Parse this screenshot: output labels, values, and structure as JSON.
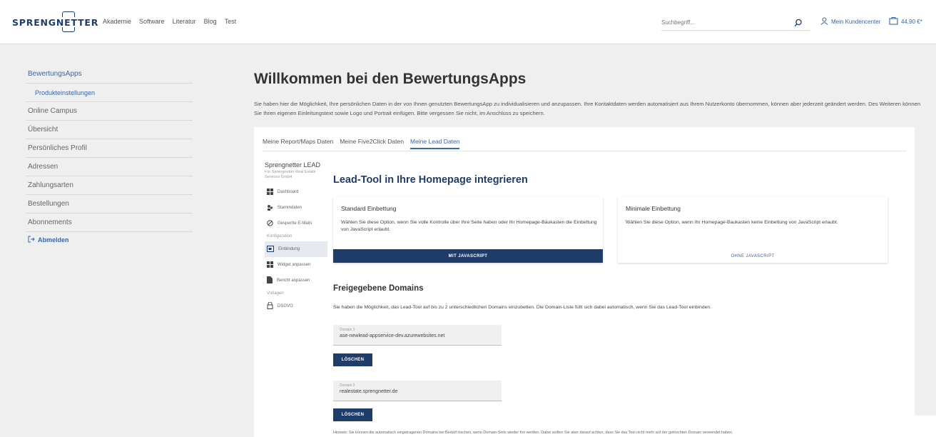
{
  "header": {
    "logo": "SPRENGNETTER",
    "nav": [
      "Akademie",
      "Software",
      "Literatur",
      "Blog",
      "Test"
    ],
    "search_placeholder": "Suchbegriff...",
    "account_label": "Mein Kundencenter",
    "cart_amount": "44,90 €*",
    "accent_color": "#3a67a8"
  },
  "sidebar": {
    "items": [
      {
        "label": "BewertungsApps",
        "active": true
      },
      {
        "label": "Produkteinstellungen",
        "sub": true
      },
      {
        "label": "Online Campus"
      },
      {
        "label": "Übersicht"
      },
      {
        "label": "Persönliches Profil"
      },
      {
        "label": "Adressen"
      },
      {
        "label": "Zahlungsarten"
      },
      {
        "label": "Bestellungen"
      },
      {
        "label": "Abonnements"
      }
    ],
    "logout": "Abmelden"
  },
  "main": {
    "title": "Willkommen bei den BewertungsApps",
    "intro": "Sie haben hier die Möglichkeit, Ihre persönlichen Daten in der von Ihnen genutzten BewertungsApp zu individualisieren und anzupassen. Ihre Kontaktdaten werden automatisiert aus Ihrem Nutzerkonto übernommen, können aber jederzeit geändert werden. Des Weiteren können Sie Ihren eigenen Einleitungstext sowie Logo und Portrait einfügen. Bitte vergessen Sie nicht, im Anschluss zu speichern.",
    "tabs": [
      {
        "label": "Meine Report/Maps Daten"
      },
      {
        "label": "Meine Five2Click Daten"
      },
      {
        "label": "Meine Lead Daten",
        "active": true
      }
    ]
  },
  "leadnav": {
    "brand": "Sprengnetter LEAD",
    "brand_sub": "Für Sprengnetter Real Estate Services GmbH",
    "items": [
      {
        "label": "Dashboard",
        "icon": "dashboard-icon"
      },
      {
        "label": "Stammdaten",
        "icon": "users-icon"
      },
      {
        "label": "Gesperrte E-Mails",
        "icon": "blocked-icon"
      }
    ],
    "section_config": "Konfiguration",
    "config_items": [
      {
        "label": "Einbindung",
        "icon": "embed-icon",
        "active": true
      },
      {
        "label": "Widget anpassen",
        "icon": "widget-icon"
      },
      {
        "label": "Bericht anpassen",
        "icon": "report-icon"
      }
    ],
    "section_templates": "Vorlagen",
    "template_items": [
      {
        "label": "DSGVO",
        "icon": "lock-icon"
      }
    ]
  },
  "lead": {
    "title": "Lead-Tool in Ihre Homepage integrieren",
    "option1": {
      "title": "Standard Einbettung",
      "text": "Wählen Sie diese Option, wenn Sie volle Kontrolle über Ihre Seite haben oder Ihr Homepage-Baukasten die Einbettung von JavaScript erlaubt.",
      "button": "MIT JAVASCRIPT"
    },
    "option2": {
      "title": "Minimale Einbettung",
      "text": "Wählen Sie diese Option, wenn Ihr Homepage-Baukasten keine Einbettung von JavaScript erlaubt.",
      "button": "OHNE JAVASCRIPT"
    },
    "domains_title": "Freigegebene Domains",
    "domains_desc": "Sie haben die Möglichkeit, das Lead-Tool auf bis zu 2 unterschiedlichen Domains einzubetten. Die Domain-Liste füllt sich dabei automatisch, wenn Sie das Lead-Tool einbinden.",
    "domains": [
      {
        "label": "Domain 1",
        "value": "ase-newlead-appservice-dev.azurewebsites.net",
        "button": "LÖSCHEN"
      },
      {
        "label": "Domain 2",
        "value": "realestate.sprengnetter.de",
        "button": "LÖSCHEN"
      }
    ],
    "note": "Hinweis: Sie können die automatisch eingetragenen Domains bei Bedarf löschen, wenn Domain-Slots wieder frei werden. Dabei sollten Sie aber darauf achten, dass Sie das Tool nicht mehr auf der gelöschten Domain verwendet haben."
  }
}
